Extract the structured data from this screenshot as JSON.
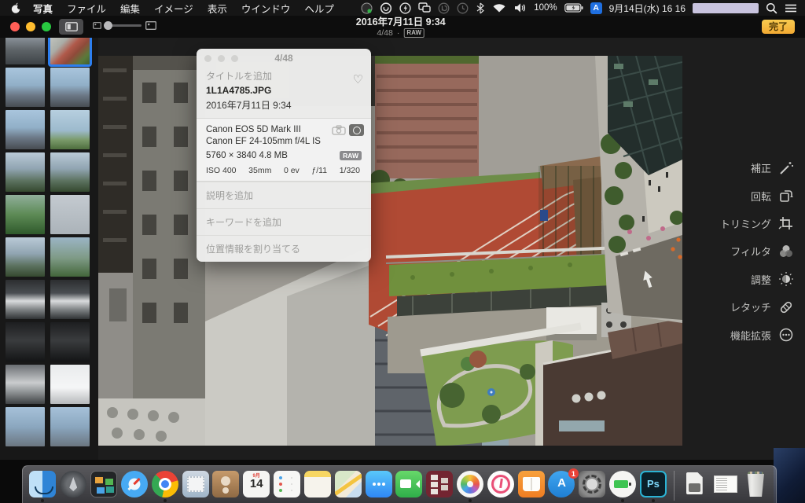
{
  "menu_bar": {
    "apple_icon": "apple-logo",
    "items": [
      "写真",
      "ファイル",
      "編集",
      "イメージ",
      "表示",
      "ウインドウ",
      "ヘルプ"
    ],
    "status": {
      "battery_percent": "100%",
      "input_label": "A",
      "datetime": "9月14日(水) 16 16"
    }
  },
  "titlebar": {
    "title": "2016年7月11日 9:34",
    "counter": "4/48",
    "separator": "·",
    "raw_label": "RAW",
    "done_label": "完了"
  },
  "info_popover": {
    "counter": "4/48",
    "title_placeholder": "タイトルを追加",
    "filename": "1L1A4785.JPG",
    "datetime": "2016年7月11日  9:34",
    "heart_glyph": "♡",
    "camera": "Canon EOS 5D Mark III",
    "lens": "Canon EF 24-105mm f/4L IS",
    "dimensions": "5760 × 3840 4.8 MB",
    "raw_badge": "RAW",
    "exif": [
      "ISO 400",
      "35mm",
      "0 ev",
      "ƒ/11",
      "1/320"
    ],
    "description_placeholder": "説明を追加",
    "keywords_placeholder": "キーワードを追加",
    "location_placeholder": "位置情報を割り当てる"
  },
  "tools": [
    {
      "label": "補正",
      "icon": "wand"
    },
    {
      "label": "回転",
      "icon": "rotate"
    },
    {
      "label": "トリミング",
      "icon": "crop"
    },
    {
      "label": "フィルタ",
      "icon": "filters"
    },
    {
      "label": "調整",
      "icon": "adjust"
    },
    {
      "label": "レタッチ",
      "icon": "retouch"
    },
    {
      "label": "機能拡張",
      "icon": "extensions"
    }
  ],
  "thumbnails": [
    {
      "scene": "city-tall",
      "selected": false
    },
    {
      "scene": "rooftop-track",
      "selected": true
    },
    {
      "scene": "skyline",
      "selected": false
    },
    {
      "scene": "skyline",
      "selected": false
    },
    {
      "scene": "skyline",
      "selected": false
    },
    {
      "scene": "landgreen",
      "selected": false
    },
    {
      "scene": "mountains",
      "selected": false
    },
    {
      "scene": "mountains",
      "selected": false
    },
    {
      "scene": "greenhill",
      "selected": false
    },
    {
      "scene": "graysky",
      "selected": false
    },
    {
      "scene": "mountains",
      "selected": false
    },
    {
      "scene": "fields",
      "selected": false
    },
    {
      "scene": "train",
      "selected": false
    },
    {
      "scene": "train",
      "selected": false
    },
    {
      "scene": "station",
      "selected": false
    },
    {
      "scene": "station",
      "selected": false
    },
    {
      "scene": "tram",
      "selected": false
    },
    {
      "scene": "whitewin",
      "selected": false
    },
    {
      "scene": "cityblue",
      "selected": false
    },
    {
      "scene": "cityblue",
      "selected": false
    }
  ],
  "photo": {
    "description": "Aerial daytime view of city rooftops with a red running track, rooftop garden, courtyard and glass towers"
  },
  "dock": {
    "items": [
      {
        "name": "finder",
        "kind": "finder",
        "running": true
      },
      {
        "name": "launchpad",
        "kind": "launchpad",
        "running": false
      },
      {
        "name": "mission-control",
        "kind": "missioncontrol",
        "running": false
      },
      {
        "name": "safari",
        "kind": "safari",
        "running": false
      },
      {
        "name": "chrome",
        "kind": "chrome",
        "running": true
      },
      {
        "name": "mail",
        "kind": "mail",
        "running": false
      },
      {
        "name": "contacts",
        "kind": "contacts",
        "running": false
      },
      {
        "name": "calendar",
        "kind": "calendar",
        "running": false,
        "month": "9月",
        "day": "14"
      },
      {
        "name": "reminders",
        "kind": "reminders",
        "running": false
      },
      {
        "name": "notes",
        "kind": "notes",
        "running": false
      },
      {
        "name": "maps",
        "kind": "maps",
        "running": false
      },
      {
        "name": "messages",
        "kind": "messages",
        "running": false
      },
      {
        "name": "facetime",
        "kind": "facetime",
        "running": false
      },
      {
        "name": "photo-booth",
        "kind": "photobooth",
        "running": false
      },
      {
        "name": "photos",
        "kind": "photos",
        "running": true
      },
      {
        "name": "itunes",
        "kind": "itunes",
        "running": false
      },
      {
        "name": "ibooks",
        "kind": "ibooks",
        "running": false
      },
      {
        "name": "app-store",
        "kind": "appstore",
        "running": false,
        "badge": "1",
        "letter": "A"
      },
      {
        "name": "system-preferences",
        "kind": "systemprefs",
        "running": false
      },
      {
        "name": "battery-utility",
        "kind": "battery",
        "running": true
      },
      {
        "name": "photoshop",
        "kind": "photoshop",
        "running": true,
        "label": "Ps"
      },
      {
        "name": "separator",
        "kind": "separator",
        "running": false
      },
      {
        "name": "documents",
        "kind": "documents",
        "running": false
      },
      {
        "name": "text-file",
        "kind": "textfile",
        "running": false
      },
      {
        "name": "trash",
        "kind": "trash",
        "running": false
      }
    ]
  }
}
